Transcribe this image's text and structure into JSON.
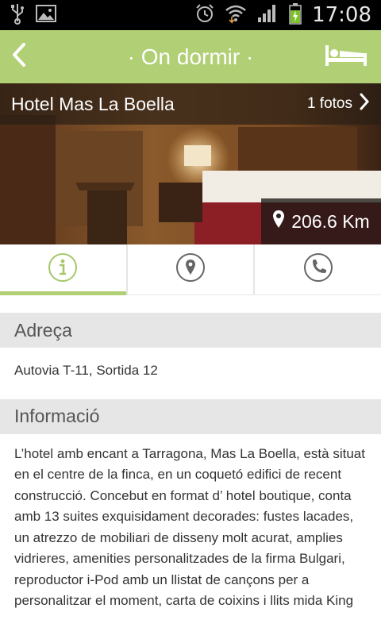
{
  "status_bar": {
    "time": "17:08"
  },
  "header": {
    "title": "· On dormir ·"
  },
  "hotel": {
    "name": "Hotel Mas La Boella",
    "photos_label": "1 fotos",
    "distance": "206.6 Km"
  },
  "tabs": [
    {
      "icon": "info-icon",
      "active": true
    },
    {
      "icon": "map-pin-icon",
      "active": false
    },
    {
      "icon": "phone-icon",
      "active": false
    }
  ],
  "address_section": {
    "heading": "Adreça",
    "text": "Autovia T-11, Sortida 12"
  },
  "info_section": {
    "heading": "Informació",
    "text": "L’hotel amb encant a Tarragona, Mas La Boella, està situat en el centre de la finca, en un coquetó edifici de recent construcció. Concebut en format d’ hotel boutique, conta amb 13 suites exquisidament decorades: fustes lacades, un atrezzo de mobiliari de disseny molt acurat, amplies vidrieres, amenities personalitzades de la firma Bulgari, reproductor i-Pod amb un llistat de cançons per a personalitzar el moment, carta de coixins i llits mida King"
  },
  "colors": {
    "accent": "#b1cf75",
    "section_bg": "#e6e6e6"
  }
}
